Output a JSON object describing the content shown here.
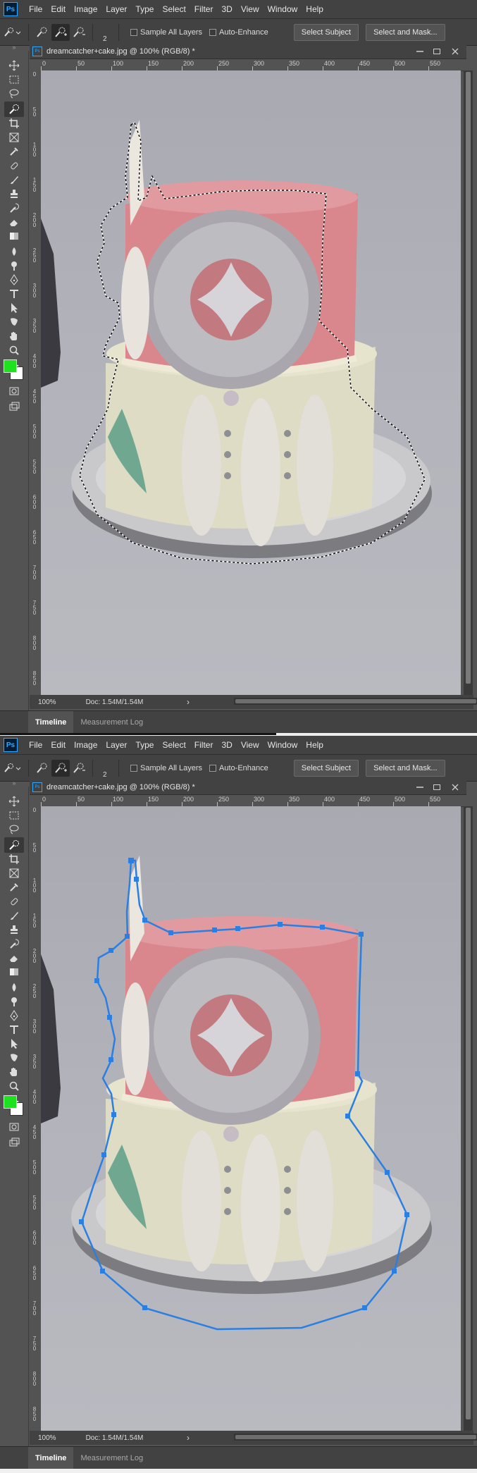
{
  "menu": {
    "logo": "Ps",
    "items": [
      "File",
      "Edit",
      "Image",
      "Layer",
      "Type",
      "Select",
      "Filter",
      "3D",
      "View",
      "Window",
      "Help"
    ]
  },
  "options": {
    "brush_size": "2",
    "sample_all_layers": "Sample All Layers",
    "auto_enhance": "Auto-Enhance",
    "select_subject": "Select Subject",
    "select_and_mask": "Select and Mask..."
  },
  "document": {
    "badge": "Ps",
    "title": "dreamcatcher+cake.jpg @ 100% (RGB/8) *",
    "ruler_h": [
      "0",
      "50",
      "100",
      "150",
      "200",
      "250",
      "300",
      "350",
      "400",
      "450",
      "500",
      "550"
    ],
    "ruler_v": [
      "0",
      "50",
      "100",
      "150",
      "200",
      "250",
      "300",
      "350",
      "400",
      "450",
      "500",
      "550",
      "600",
      "650",
      "700",
      "750",
      "800",
      "850"
    ]
  },
  "status": {
    "zoom": "100%",
    "doc_size": "Doc: 1.54M/1.54M"
  },
  "panel_tabs": [
    "Timeline",
    "Measurement Log"
  ],
  "colors": {
    "foreground": "#1fe21f",
    "background": "#ffffff",
    "selection_path": "#2b7fe0",
    "brand": "#31a8ff"
  },
  "icons": {
    "toolbar": [
      "move-icon",
      "marquee-icon",
      "lasso-icon",
      "quick-selection-icon",
      "crop-icon",
      "frame-icon",
      "eyedropper-icon",
      "healing-brush-icon",
      "brush-icon",
      "clone-stamp-icon",
      "history-brush-icon",
      "eraser-icon",
      "gradient-icon",
      "blur-icon",
      "dodge-icon",
      "pen-icon",
      "type-icon",
      "path-selection-icon",
      "shape-icon",
      "hand-icon",
      "zoom-icon",
      "more-tools-icon",
      "quick-mask-icon",
      "screen-mode-icon"
    ]
  }
}
